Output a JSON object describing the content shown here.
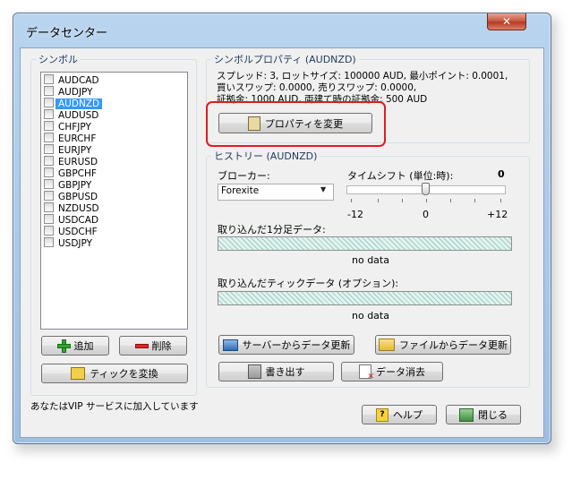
{
  "window": {
    "title": "データセンター",
    "close_glyph": "✕"
  },
  "symbols": {
    "group_label": "シンボル",
    "items": [
      "AUDCAD",
      "AUDJPY",
      "AUDNZD",
      "AUDUSD",
      "CHFJPY",
      "EURCHF",
      "EURJPY",
      "EURUSD",
      "GBPCHF",
      "GBPJPY",
      "GBPUSD",
      "NZDUSD",
      "USDCAD",
      "USDCHF",
      "USDJPY"
    ],
    "selected": "AUDNZD",
    "add_label": "追加",
    "delete_label": "削除",
    "convert_ticks_label": "ティックを変換"
  },
  "properties": {
    "group_label": "シンボルプロパティ (AUDNZD)",
    "line1": "スプレッド: 3, ロットサイズ: 100000 AUD, 最小ポイント: 0.0001,",
    "line2": "買いスワップ: 0.0000, 売りスワップ: 0.0000,",
    "line3": "証拠金: 1000 AUD, 両建て時の証拠金: 500 AUD",
    "change_button_label": "プロパティを変更"
  },
  "history": {
    "group_label": "ヒストリー (AUDNZD)",
    "broker_label": "ブローカー:",
    "broker_value": "Forexite",
    "timeshift_label": "タイムシフト (単位:時):",
    "timeshift_value": "0",
    "slider_min": "-12",
    "slider_mid": "0",
    "slider_max": "+12",
    "minute_data_label": "取り込んだ1分足データ:",
    "minute_data_status": "no data",
    "tick_data_label": "取り込んだティックデータ (オプション):",
    "tick_data_status": "no data",
    "update_server_label": "サーバーからデータ更新",
    "update_file_label": "ファイルからデータ更新",
    "export_label": "書き出す",
    "delete_data_label": "データ消去"
  },
  "footer": {
    "vip_status": "あなたはVIP サービスに加入しています",
    "help_label": "ヘルプ",
    "close_label": "閉じる"
  },
  "colors": {
    "highlight": "#e01c1c",
    "selection": "#3399ff",
    "title_bar": "#b9d4ee"
  }
}
